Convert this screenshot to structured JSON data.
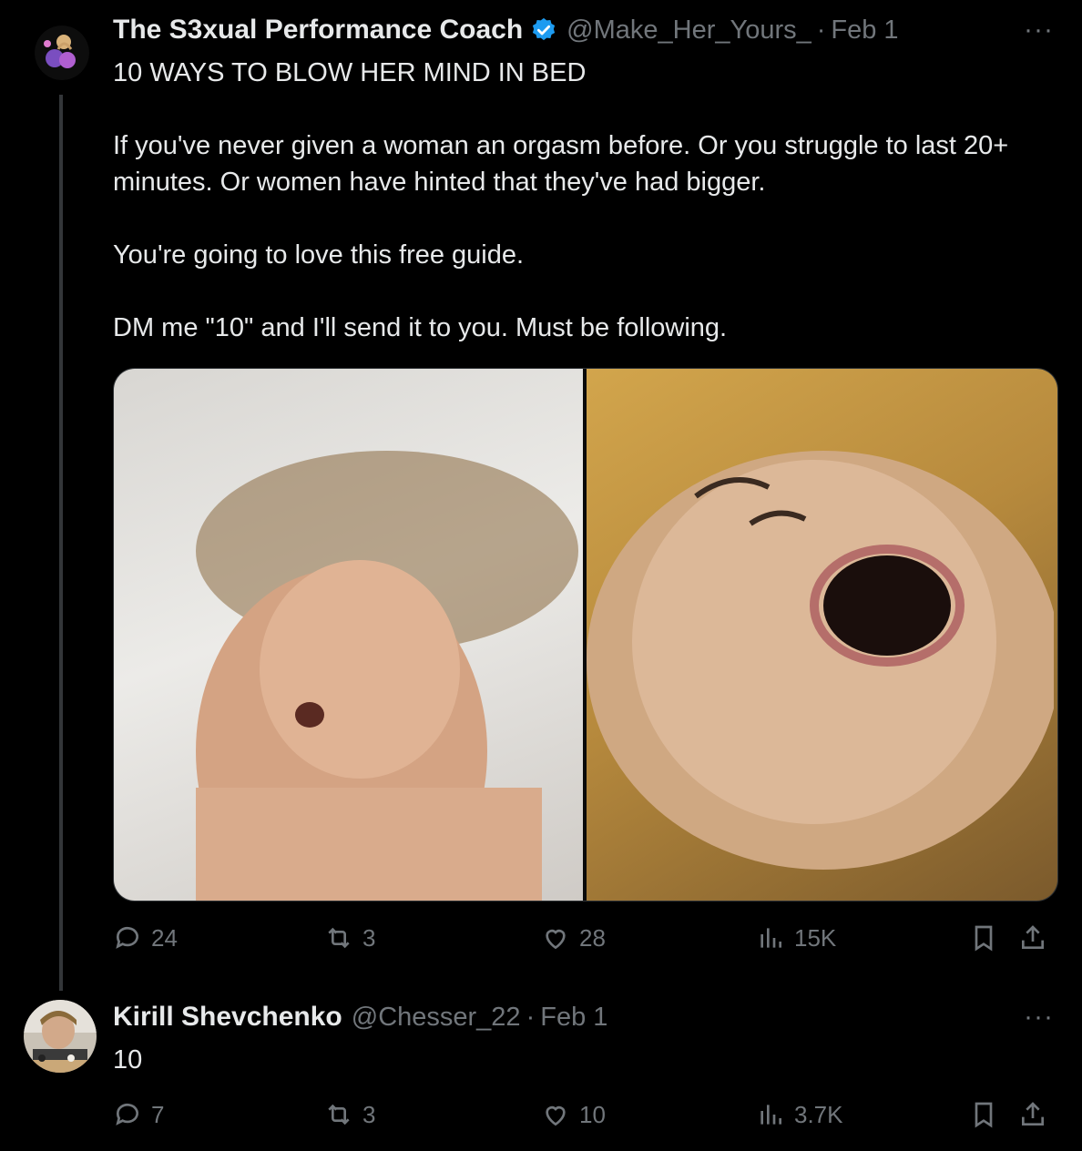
{
  "post": {
    "author_name": "The S3xual Performance Coach",
    "handle": "@Make_Her_Yours_",
    "separator": "·",
    "date": "Feb 1",
    "more": "···",
    "lines": [
      "10 WAYS TO BLOW HER MIND IN BED",
      "If you've never given a woman an orgasm before. Or you struggle to last 20+",
      "minutes. Or women have hinted that they've had bigger.",
      "You're going to love this free guide.",
      "DM me \"10\" and I'll send it to you. Must be following."
    ],
    "actions": {
      "replies": "24",
      "reposts": "3",
      "likes": "28",
      "views": "15K"
    }
  },
  "reply": {
    "author_name": "Kirill Shevchenko",
    "handle": "@Chesser_22",
    "separator": "·",
    "date": "Feb 1",
    "more": "···",
    "text": "10",
    "actions": {
      "replies": "7",
      "reposts": "3",
      "likes": "10",
      "views": "3.7K"
    }
  },
  "icons": {
    "verified": "verified-badge-icon",
    "reply": "reply-icon",
    "repost": "repost-icon",
    "like": "heart-icon",
    "views": "views-icon",
    "bookmark": "bookmark-icon",
    "share": "share-icon"
  },
  "colors": {
    "background": "#000000",
    "text": "#e7e9ea",
    "muted": "#71767b",
    "verified": "#1d9bf0"
  }
}
